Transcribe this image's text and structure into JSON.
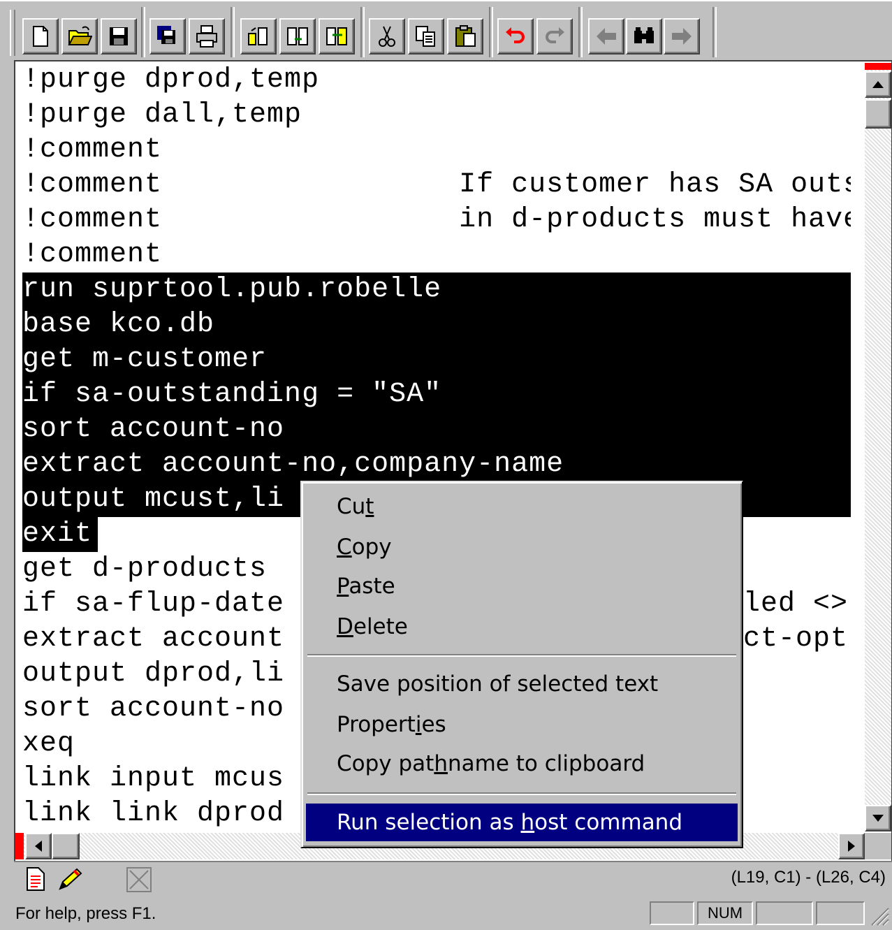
{
  "toolbar": {
    "buttons": [
      {
        "name": "new-document-button",
        "icon": "new-document-icon"
      },
      {
        "name": "open-folder-button",
        "icon": "open-folder-icon"
      },
      {
        "name": "save-button",
        "icon": "floppy-disk-icon"
      },
      {
        "name": "save-all-button",
        "icon": "multiple-floppy-icon"
      },
      {
        "name": "print-button",
        "icon": "printer-icon"
      },
      {
        "name": "tool-1-button",
        "icon": "file-transfer-icon"
      },
      {
        "name": "tool-2-button",
        "icon": "file-transfer-icon"
      },
      {
        "name": "tool-3-button",
        "icon": "file-transfer-icon"
      },
      {
        "name": "cut-button",
        "icon": "scissors-icon"
      },
      {
        "name": "copy-button",
        "icon": "copy-icon"
      },
      {
        "name": "paste-button",
        "icon": "clipboard-icon"
      },
      {
        "name": "undo-button",
        "icon": "undo-arrow-icon"
      },
      {
        "name": "redo-button",
        "icon": "redo-arrow-icon"
      },
      {
        "name": "find-previous-button",
        "icon": "left-arrow-icon"
      },
      {
        "name": "find-button",
        "icon": "binoculars-icon"
      },
      {
        "name": "find-next-button",
        "icon": "right-arrow-icon"
      }
    ]
  },
  "editor": {
    "lines": [
      "!purge dprod,temp",
      "!purge dall,temp",
      "!comment",
      "!comment                 If customer has SA outsta",
      "!comment                 in d-products must have s",
      "!comment",
      "run suprtool.pub.robelle",
      "base kco.db",
      "get m-customer",
      "if sa-outstanding = \"SA\"",
      "sort account-no",
      "extract account-no,company-name",
      "output mcust,li",
      "exit",
      "get d-products",
      "if sa-flup-date",
      "extract account",
      "output dprod,li",
      "sort account-no",
      "xeq",
      "link input mcus",
      "link link dprod"
    ],
    "right_fragments": {
      "line16": "led <>",
      "line17": "ct-opt"
    }
  },
  "context_menu": {
    "items": [
      {
        "before": "Cu",
        "key": "t",
        "after": ""
      },
      {
        "before": "",
        "key": "C",
        "after": "opy"
      },
      {
        "before": "",
        "key": "P",
        "after": "aste"
      },
      {
        "before": "",
        "key": "D",
        "after": "elete"
      },
      {
        "before": "Save position of selected text",
        "key": "",
        "after": ""
      },
      {
        "before": "Propert",
        "key": "i",
        "after": "es"
      },
      {
        "before": "Copy pat",
        "key": "h",
        "after": "name to clipboard"
      },
      {
        "before": "Run selection as ",
        "key": "h",
        "after": "ost command"
      }
    ]
  },
  "doc_status": {
    "position": "(L19, C1) - (L26, C4)"
  },
  "status_bar": {
    "help": "For help, press F1.",
    "num": "NUM"
  },
  "colors": {
    "selection_bg": "#000000",
    "menu_highlight": "#000080",
    "chrome": "#c0c0c0",
    "marker": "#ff0000"
  }
}
